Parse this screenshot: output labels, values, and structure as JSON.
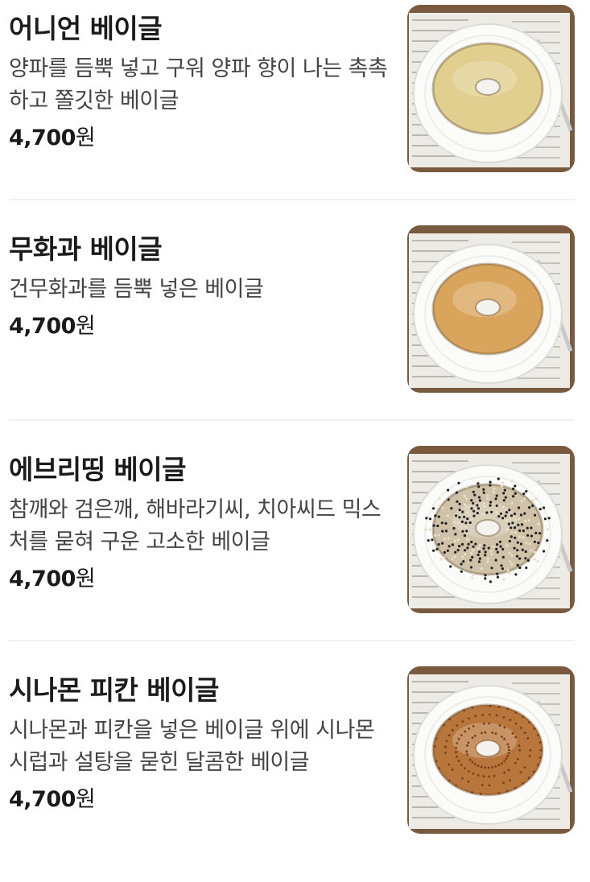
{
  "menu": {
    "items": [
      {
        "title": "어니언 베이글",
        "description": "양파를 듬뿍 넣고 구워 양파 향이 나는 촉촉하고 쫄깃한 베이글",
        "price": "4,700",
        "currency": "원",
        "image": "onion-bagel-photo",
        "bagel_color": "#e0cf8e",
        "seed": "none"
      },
      {
        "title": "무화과 베이글",
        "description": "건무화과를 듬뿍 넣은 베이글",
        "price": "4,700",
        "currency": "원",
        "image": "fig-bagel-photo",
        "bagel_color": "#d9a45c",
        "seed": "none"
      },
      {
        "title": "에브리띵 베이글",
        "description": "참깨와 검은깨, 해바라기씨, 치아씨드 믹스처를 묻혀 구운 고소한 베이글",
        "price": "4,700",
        "currency": "원",
        "image": "everything-bagel-photo",
        "bagel_color": "#cfc2a8",
        "seed": "seeds"
      },
      {
        "title": "시나몬 피칸 베이글",
        "description": "시나몬과 피칸을 넣은 베이글 위에 시나몬 시럽과 설탕을 묻힌 달콤한 베이글",
        "price": "4,700",
        "currency": "원",
        "image": "cinnamon-pecan-bagel-photo",
        "bagel_color": "#b8763d",
        "seed": "cinnamon"
      }
    ]
  }
}
